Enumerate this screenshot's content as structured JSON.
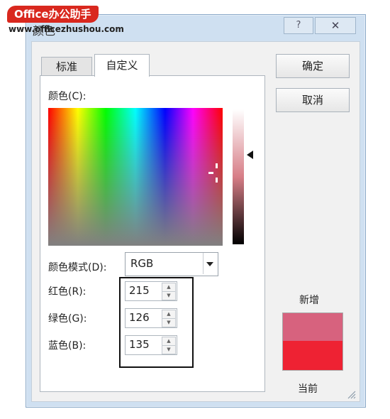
{
  "watermark": {
    "logo": "Office办公助手",
    "url": "www.officezhushou.com"
  },
  "window": {
    "title": "颜色",
    "help_glyph": "?",
    "close_glyph": "✕"
  },
  "tabs": [
    {
      "label": "标准"
    },
    {
      "label": "自定义"
    }
  ],
  "custom": {
    "colors_label": "颜色(C):",
    "color_model_label": "颜色模式(D):",
    "color_model_value": "RGB",
    "red": {
      "label": "红色(R):",
      "value": "215"
    },
    "green": {
      "label": "绿色(G):",
      "value": "126"
    },
    "blue": {
      "label": "蓝色(B):",
      "value": "135"
    }
  },
  "buttons": {
    "ok": "确定",
    "cancel": "取消"
  },
  "preview": {
    "new_label": "新增",
    "current_label": "当前",
    "new_color": "#d7627e",
    "current_color": "#ee2233"
  },
  "icons": {
    "help": "question-icon",
    "close": "close-icon",
    "dropdown": "chevron-down-icon",
    "spin_up": "arrow-up-icon",
    "spin_down": "arrow-down-icon"
  }
}
